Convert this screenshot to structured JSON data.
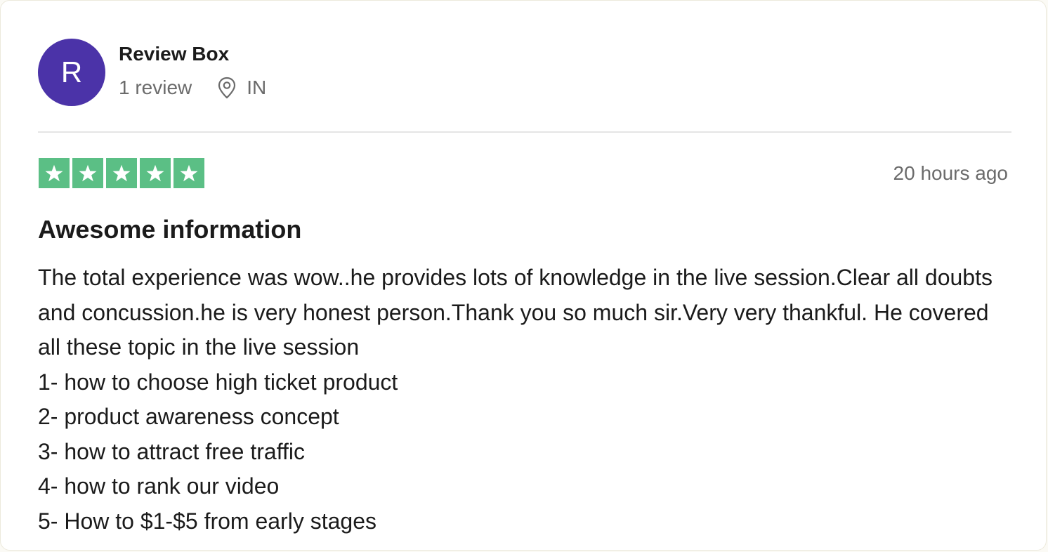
{
  "reviewer": {
    "initial": "R",
    "name": "Review Box",
    "review_count": "1 review",
    "country": "IN",
    "avatar_color": "#4b33a8"
  },
  "rating": {
    "stars": 5,
    "max": 5,
    "star_color": "#5bbf85",
    "icon": "star-icon"
  },
  "timestamp": "20 hours ago",
  "review": {
    "title": "Awesome information",
    "paragraph": "The total experience was wow..he provides lots of knowledge in the live session.Clear all doubts and concussion.he is very honest person.Thank you so much sir.Very very thankful. He covered all these topic in the live session",
    "list": [
      "1- how to choose high ticket product",
      "2- product awareness concept",
      "3- how to attract free traffic",
      "4- how to rank our video",
      "5- How to $1-$5 from early stages"
    ]
  }
}
